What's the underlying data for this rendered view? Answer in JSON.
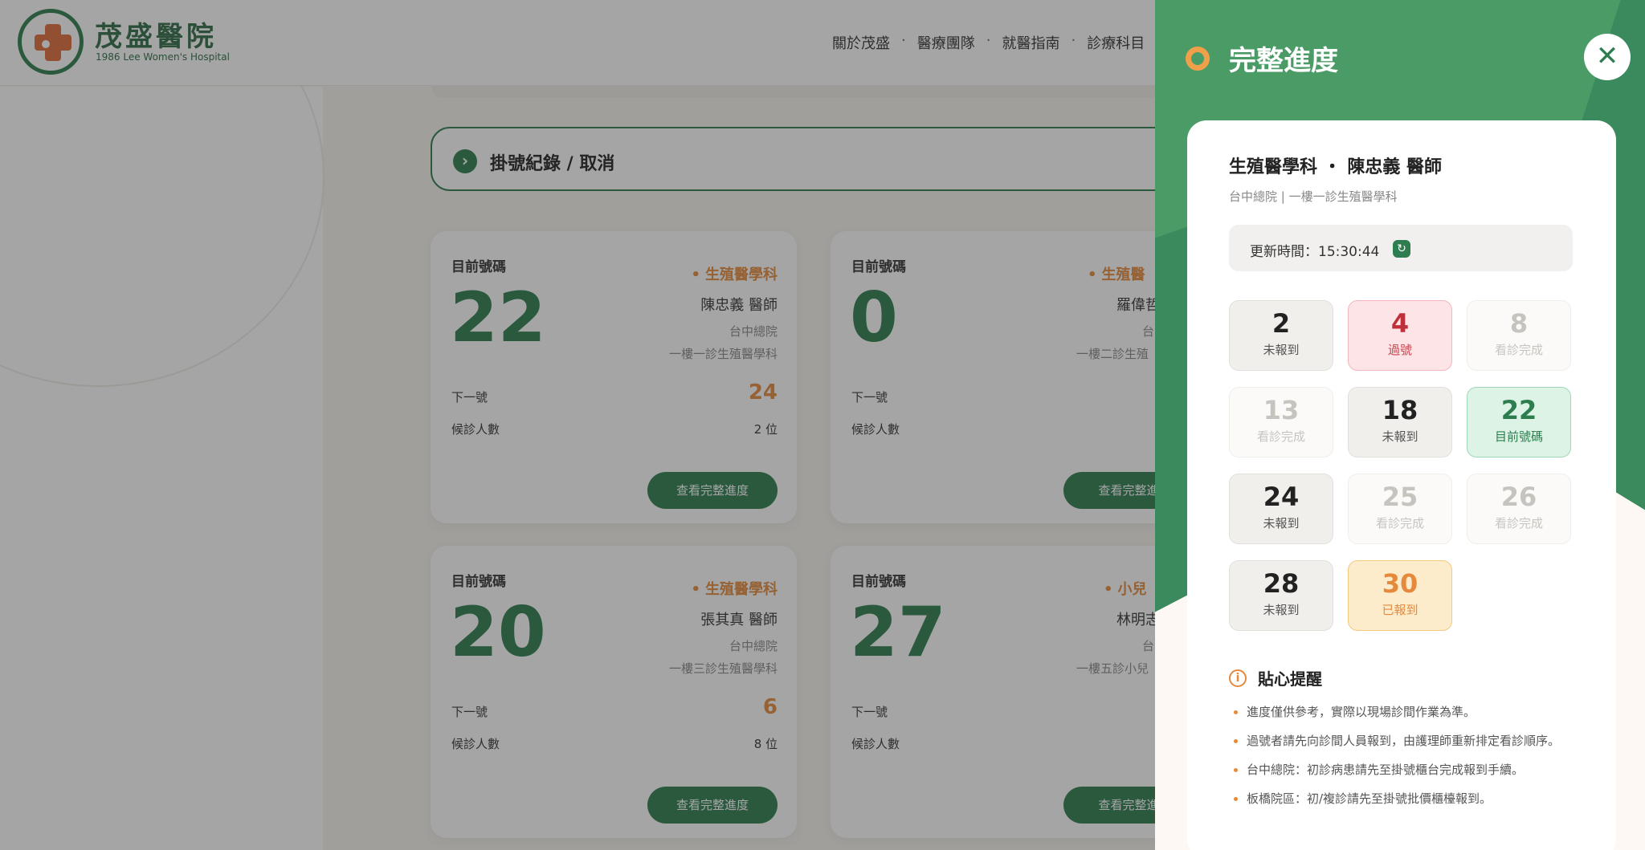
{
  "header": {
    "hospital_name": "茂盛醫院",
    "hospital_subtitle": "1986 Lee Women's Hospital",
    "nav": [
      "關於茂盛",
      "醫療團隊",
      "就醫指南",
      "診療科目"
    ]
  },
  "record_bar": {
    "label": "掛號紀錄 / 取消"
  },
  "cards": [
    {
      "current_label": "目前號碼",
      "current": "22",
      "dept": "生殖醫學科",
      "doctor": "陳忠義 醫師",
      "branch": "台中總院",
      "room": "一樓一診生殖醫學科",
      "next_label": "下一號",
      "next": "24",
      "wait_label": "候診人數",
      "wait": "2 位",
      "button": "查看完整進度"
    },
    {
      "current_label": "目前號碼",
      "current": "0",
      "dept": "生殖醫",
      "doctor": "羅偉哲",
      "branch": "台",
      "room": "一樓二診生殖",
      "next_label": "下一號",
      "next": "",
      "wait_label": "候診人數",
      "wait": "",
      "button": "查看完整進"
    },
    {
      "current_label": "目前號碼",
      "current": "20",
      "dept": "生殖醫學科",
      "doctor": "張其真 醫師",
      "branch": "台中總院",
      "room": "一樓三診生殖醫學科",
      "next_label": "下一號",
      "next": "6",
      "wait_label": "候診人數",
      "wait": "8 位",
      "button": "查看完整進度"
    },
    {
      "current_label": "目前號碼",
      "current": "27",
      "dept": "小兒",
      "doctor": "林明志",
      "branch": "台",
      "room": "一樓五診小兒",
      "next_label": "下一號",
      "next": "",
      "wait_label": "候診人數",
      "wait": "",
      "button": "查看完整進"
    }
  ],
  "drawer": {
    "title": "完整進度",
    "close_label": "✕",
    "dept_line": "生殖醫學科 ・ 陳忠義 醫師",
    "location": "台中總院 | 一樓一診生殖醫學科",
    "update_time": "更新時間：15:30:44",
    "tiles": [
      {
        "number": "2",
        "status": "未報到",
        "state": "none"
      },
      {
        "number": "4",
        "status": "過號",
        "state": "miss"
      },
      {
        "number": "8",
        "status": "看診完成",
        "state": "done"
      },
      {
        "number": "13",
        "status": "看診完成",
        "state": "done"
      },
      {
        "number": "18",
        "status": "未報到",
        "state": "none"
      },
      {
        "number": "22",
        "status": "目前號碼",
        "state": "current"
      },
      {
        "number": "24",
        "status": "未報到",
        "state": "none"
      },
      {
        "number": "25",
        "status": "看診完成",
        "state": "done"
      },
      {
        "number": "26",
        "status": "看診完成",
        "state": "done"
      },
      {
        "number": "28",
        "status": "未報到",
        "state": "none"
      },
      {
        "number": "30",
        "status": "已報到",
        "state": "arrived"
      }
    ],
    "tips_title": "貼心提醒",
    "tips": [
      "進度僅供參考，實際以現場診間作業為準。",
      "過號者請先向診間人員報到，由護理師重新排定看診順序。",
      "台中總院：初診病患請先至掛號櫃台完成報到手續。",
      "板橋院區：初/複診請先至掛號批價櫃檯報到。"
    ]
  },
  "colors": {
    "primary_green": "#2e7d4f",
    "accent_orange": "#e58a3c",
    "miss_red": "#c0303a"
  }
}
